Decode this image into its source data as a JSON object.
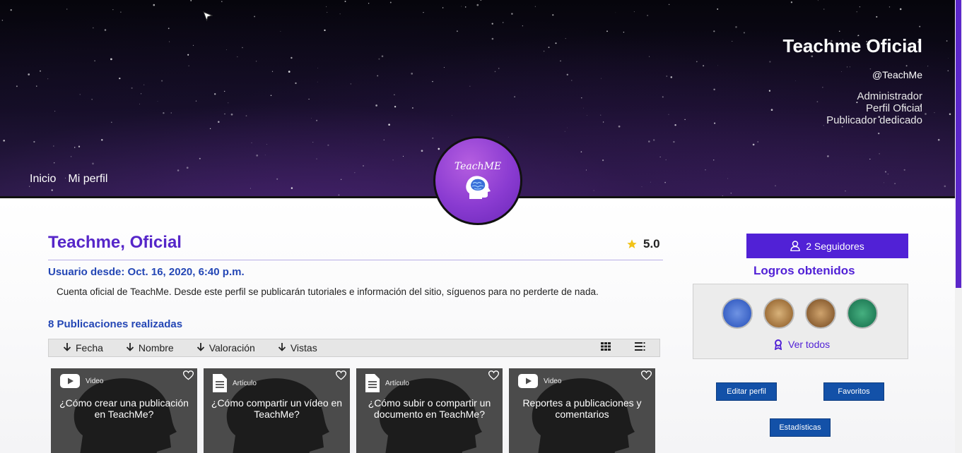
{
  "header": {
    "nav": [
      "Inicio",
      "Mi perfil"
    ],
    "name": "Teachme Oficial",
    "handle": "@TeachMe",
    "roles": [
      "Administrador",
      "Perfil Oficial",
      "Publicador dedicado"
    ],
    "avatar_text": "TeachME"
  },
  "profile": {
    "title": "Teachme, Oficial",
    "rating": "5.0",
    "since": "Usuario desde: Oct. 16, 2020, 6:40 p.m.",
    "description": "Cuenta oficial de TeachMe. Desde este perfil se publicarán tutoriales e información del sitio, síguenos para no perderte de nada.",
    "publications": "8 Publicaciones realizadas"
  },
  "sort": [
    "Fecha",
    "Nombre",
    "Valoración",
    "Vistas"
  ],
  "cards": [
    {
      "type": "Video",
      "icon": "youtube-icon",
      "title": "¿Cómo crear una publicación en TeachMe?"
    },
    {
      "type": "Artículo",
      "icon": "document-icon",
      "title": "¿Cómo compartir un vídeo en TeachMe?"
    },
    {
      "type": "Artículo",
      "icon": "document-icon",
      "title": "¿Cómo subir o compartir un documento en TeachMe?"
    },
    {
      "type": "Video",
      "icon": "youtube-icon",
      "title": "Reportes a publicaciones y comentarios"
    }
  ],
  "sidebar": {
    "followers": "2 Seguidores",
    "logros_title": "Logros obtenidos",
    "ver_todos": "Ver todos",
    "edit": "Editar perfil",
    "favorites": "Favoritos",
    "stats": "Estadísticas"
  },
  "colors": {
    "accent": "#5121d6",
    "link_blue": "#2447b5",
    "button_blue": "#1351a8",
    "star": "#f2c318"
  }
}
